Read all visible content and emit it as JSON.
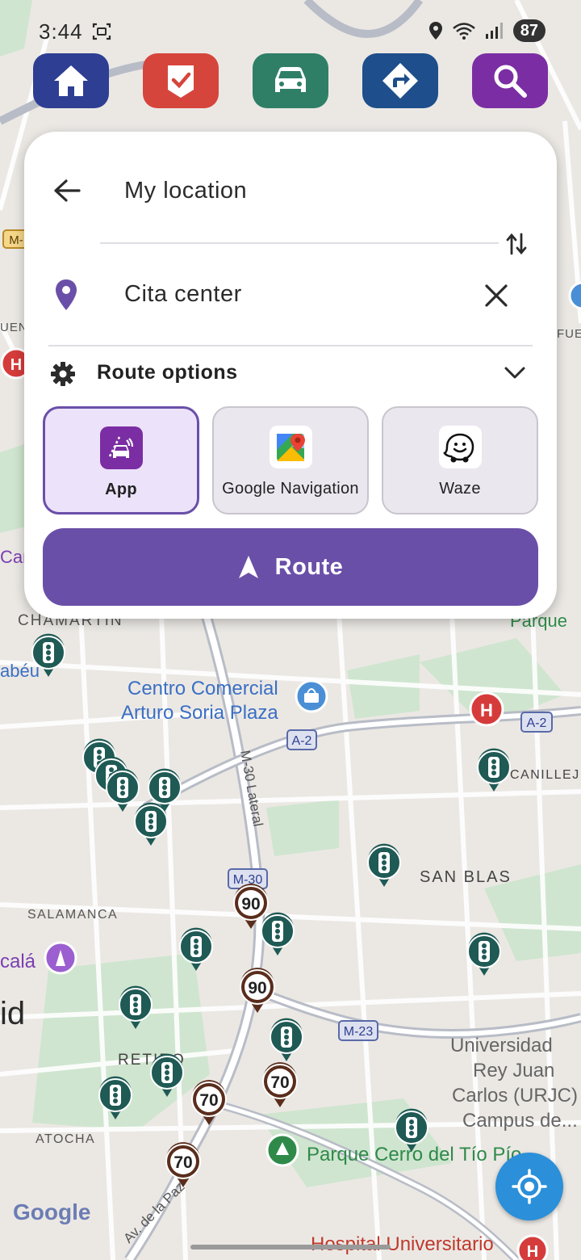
{
  "status_bar": {
    "time": "3:44",
    "battery": "87"
  },
  "toolbar": {
    "buttons": [
      {
        "icon": "home-icon",
        "color": "#2e3e93"
      },
      {
        "icon": "checklist-icon",
        "color": "#d6453c"
      },
      {
        "icon": "car-icon",
        "color": "#2f7f66"
      },
      {
        "icon": "directions-icon",
        "color": "#1e4e8b"
      },
      {
        "icon": "search-icon",
        "color": "#7b2ea3"
      }
    ]
  },
  "route_card": {
    "origin": "My location",
    "destination": "Cita center",
    "options_title": "Route options",
    "apps": [
      {
        "label": "App",
        "selected": true
      },
      {
        "label": "Google Navigation",
        "selected": false
      },
      {
        "label": "Waze",
        "selected": false
      }
    ],
    "route_button": "Route"
  },
  "map": {
    "labels": {
      "chamartin": "CHAMARTIN",
      "centro_comercial_1": "Centro Comercial",
      "centro_comercial_2": "Arturo Soria Plaza",
      "san_blas": "SAN BLAS",
      "salamanca": "SALAMANCA",
      "alcala": "calá",
      "madrid": "id",
      "retiro": "RETIRO",
      "atocha": "ATOCHA",
      "canillejas": "CANILLEJ",
      "universidad_1": "Universidad",
      "universidad_2": "Rey Juan",
      "universidad_3": "Carlos (URJC)",
      "universidad_4": "Campus de...",
      "parque_cerro": "Parque Cerro del Tío Pío",
      "hospital": "Hospital Universitario",
      "parque": "Parque",
      "abeu": "abéu",
      "can": "Can",
      "fuen_left": "UEN",
      "fuen_right": "FUE",
      "m30_lateral": "M-30 Lateral",
      "av_paz": "Av. de la Paz",
      "google": "Google"
    },
    "road_shields": {
      "a2_a": "A-2",
      "a2_b": "A-2",
      "m30": "M-30",
      "m23": "M-23",
      "m_left": "M-"
    },
    "speed_limits": [
      "90",
      "90",
      "70",
      "70",
      "70"
    ]
  },
  "colors": {
    "accent": "#6a4fa8",
    "selected_bg": "#ece3fb",
    "unselected_bg": "#ebe7ef",
    "park": "#c8e6c9",
    "water": "#a8d4f0"
  }
}
